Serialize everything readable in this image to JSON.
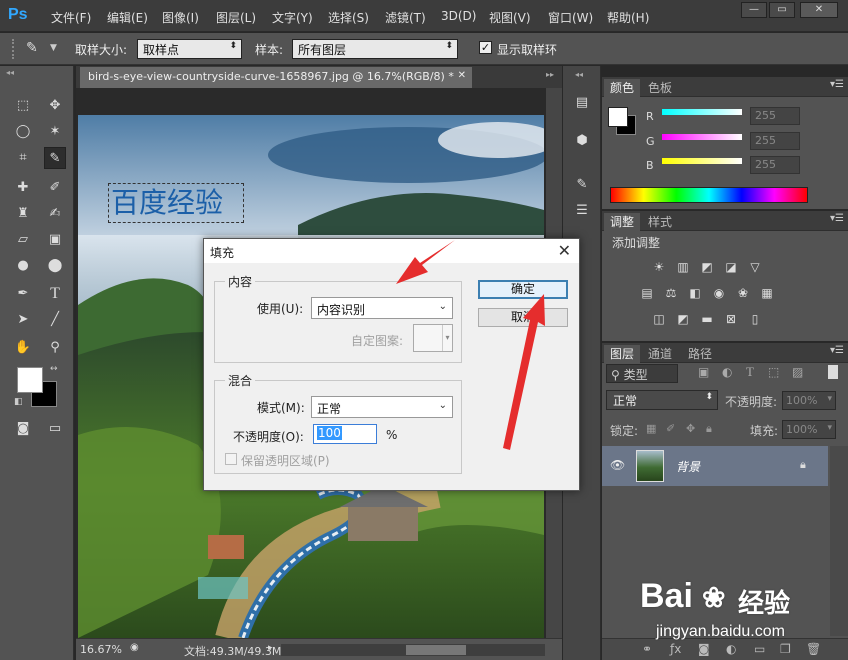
{
  "app": {
    "logo": "Ps"
  },
  "menubar": {
    "items": [
      "文件(F)",
      "编辑(E)",
      "图像(I)",
      "图层(L)",
      "文字(Y)",
      "选择(S)",
      "滤镜(T)",
      "3D(D)",
      "视图(V)",
      "窗口(W)",
      "帮助(H)"
    ],
    "window_controls": {
      "minimize": "—",
      "restore": "▭",
      "close": "✕"
    }
  },
  "options": {
    "sample_size_label": "取样大小:",
    "sample_size_value": "取样点",
    "sample_label": "样本:",
    "sample_value": "所有图层",
    "show_ring_label": "显示取样环",
    "show_ring_checked": true
  },
  "document": {
    "tab_title": "bird-s-eye-view-countryside-curve-1658967.jpg @ 16.7%(RGB/8) *",
    "text_layer": "百度经验",
    "zoom": "16.67%",
    "doc_size": "文档:49.3M/49.3M"
  },
  "color_panel": {
    "tabs": [
      "颜色",
      "色板"
    ],
    "channels": [
      {
        "label": "R",
        "value": "255",
        "color": "#00ffff"
      },
      {
        "label": "G",
        "value": "255",
        "color": "#ff00ff"
      },
      {
        "label": "B",
        "value": "255",
        "color": "#ffff00"
      }
    ]
  },
  "adjust_panel": {
    "tabs": [
      "调整",
      "样式"
    ],
    "subtitle": "添加调整",
    "row1_icons": [
      "brightness-icon",
      "levels-icon",
      "curves-icon",
      "exposure-icon",
      "vibrance-icon"
    ],
    "row2_icons": [
      "hue-sat-icon",
      "color-balance-icon",
      "bw-icon",
      "photo-filter-icon",
      "channel-mixer-icon",
      "color-lookup-icon"
    ],
    "row3_icons": [
      "invert-icon",
      "posterize-icon",
      "threshold-icon",
      "selective-color-icon",
      "gradient-map-icon"
    ]
  },
  "layers_panel": {
    "tabs": [
      "图层",
      "通道",
      "路径"
    ],
    "filter_label": "类型",
    "blend_mode": "正常",
    "opacity_label": "不透明度:",
    "opacity_value": "100%",
    "lock_label": "锁定:",
    "fill_label": "填充:",
    "fill_value": "100%",
    "layers": [
      {
        "name": "背景",
        "visible": true,
        "locked": true
      }
    ]
  },
  "fill_dialog": {
    "title": "填充",
    "content_group": "内容",
    "use_label": "使用(U):",
    "use_value": "内容识别",
    "custom_pattern_label": "自定图案:",
    "blend_group": "混合",
    "mode_label": "模式(M):",
    "mode_value": "正常",
    "opacity_label": "不透明度(O):",
    "opacity_value": "100",
    "opacity_unit": "%",
    "preserve_label": "保留透明区域(P)",
    "ok_label": "确定",
    "cancel_label": "取消",
    "close_glyph": "✕"
  },
  "watermark": {
    "logo_text": "Bai",
    "logo_text_2": "经验",
    "url": "jingyan.baidu.com"
  }
}
